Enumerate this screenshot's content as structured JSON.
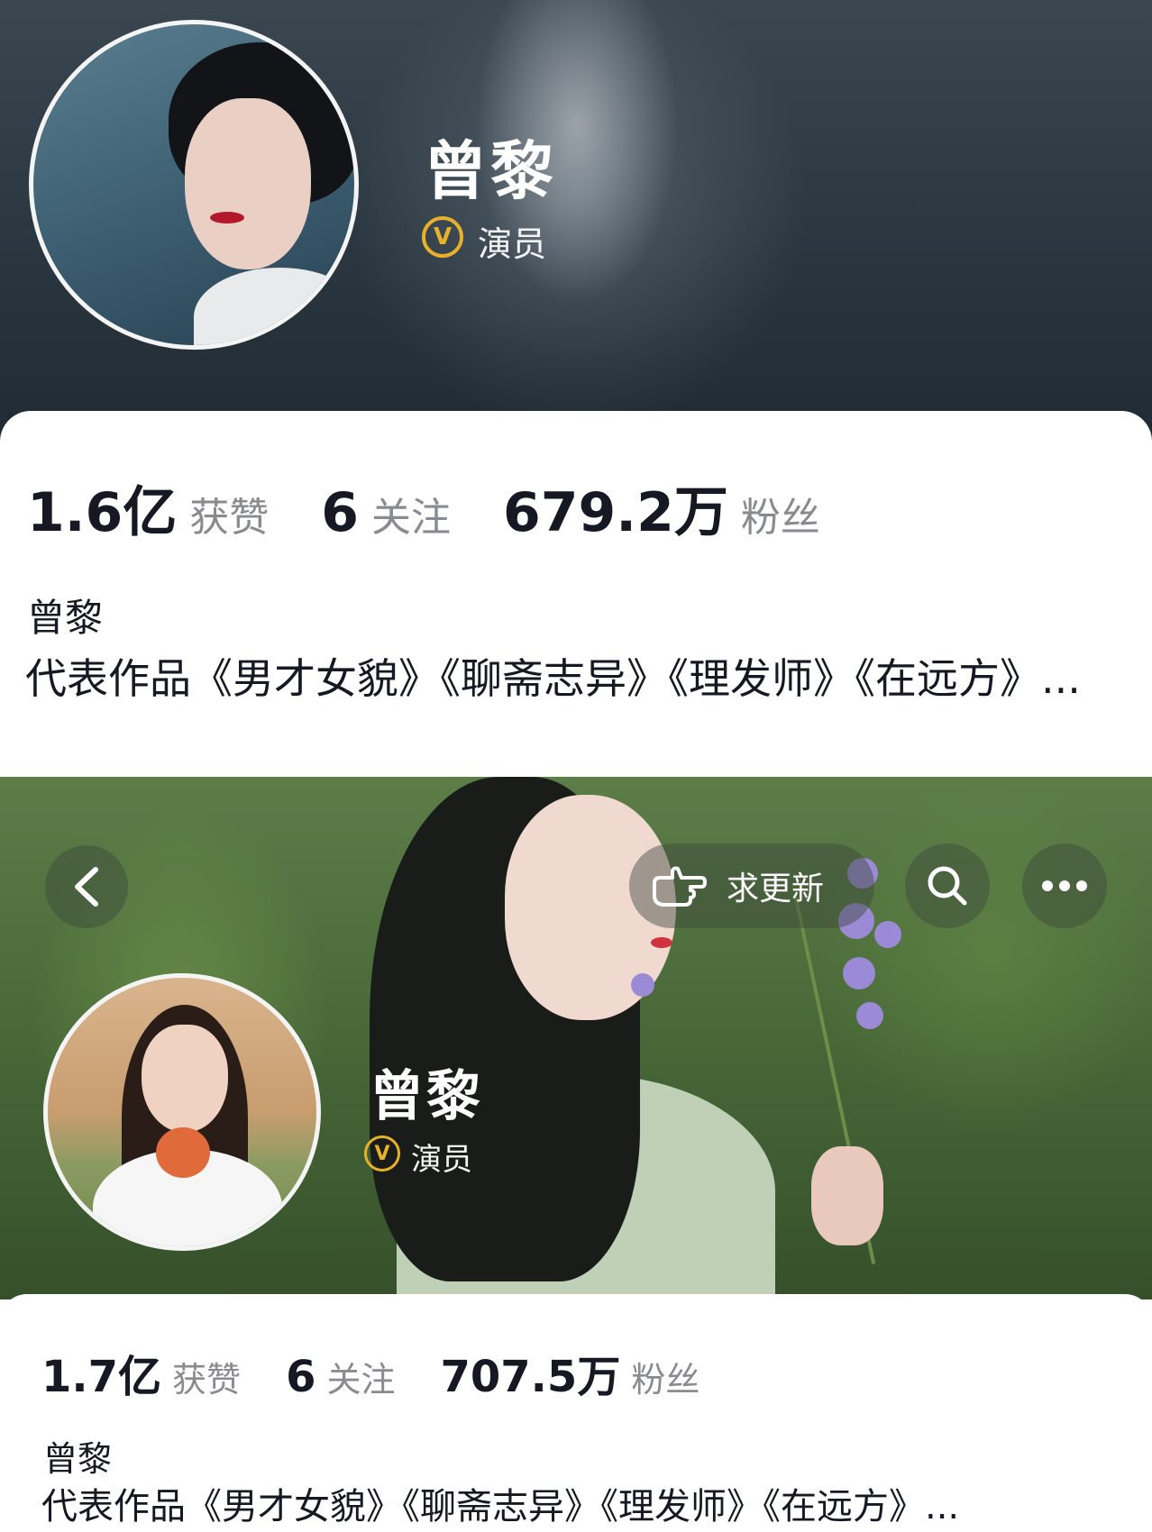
{
  "profile_top": {
    "name": "曾黎",
    "verified_role": "演员",
    "stats": {
      "likes_value": "1.6亿",
      "likes_label": "获赞",
      "following_value": "6",
      "following_label": "关注",
      "followers_value": "679.2万",
      "followers_label": "粉丝"
    },
    "nickname": "曾黎",
    "bio": "代表作品《男才女貌》《聊斋志异》《理发师》《在远方》..."
  },
  "profile_bottom": {
    "name": "曾黎",
    "verified_role": "演员",
    "header_actions": {
      "request_update_label": "求更新"
    },
    "stats": {
      "likes_value": "1.7亿",
      "likes_label": "获赞",
      "following_value": "6",
      "following_label": "关注",
      "followers_value": "707.5万",
      "followers_label": "粉丝"
    },
    "nickname": "曾黎",
    "bio": "代表作品《男才女貌》《聊斋志异》《理发师》《在远方》..."
  },
  "icons": {
    "verified": "v-badge-icon",
    "back": "chevron-left-icon",
    "request_update": "pointing-hand-icon",
    "search": "search-icon",
    "more": "more-dots-icon"
  },
  "colors": {
    "verified_badge": "#e8b12c",
    "text_primary": "#161823",
    "text_secondary": "#8a8b91"
  }
}
